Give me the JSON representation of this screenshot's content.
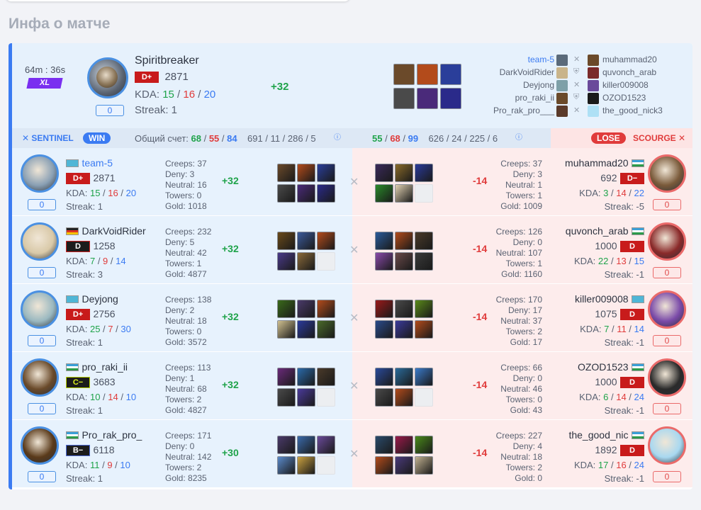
{
  "page": {
    "title": "Инфа о матче"
  },
  "summary": {
    "duration": "64m : 36s",
    "size_badge": "XL",
    "hero_name": "Spiritbreaker",
    "rank": "D+",
    "mmr": "2871",
    "kda_label": "KDA: ",
    "kills": "15",
    "deaths": "16",
    "assists": "20",
    "streak": "Streak: 1",
    "delta": "+32",
    "box_value": "0",
    "items": [
      "#6b4a2a",
      "#b34b1b",
      "#2a3e9a",
      "#4a4a4a",
      "#4a2a7a",
      "#2a2a8a"
    ],
    "sentinel_names": [
      "team-5",
      "DarkVoidRider",
      "Deyjong",
      "pro_raki_ii",
      "Pro_rak_pro___"
    ],
    "scourge_names": [
      "muhammad20",
      "quvonch_arab",
      "killer009008",
      "OZOD1523",
      "the_good_nick3"
    ],
    "mini_left": [
      "#5a6a7a",
      "#c9b48a",
      "#7ea0a8",
      "#6a4a2a",
      "#5a3a2a"
    ],
    "mini_right": [
      "#6b4a2a",
      "#7a2a2a",
      "#6a4a9a",
      "#1a1a1a",
      "#aee0f5"
    ]
  },
  "bar": {
    "sentinel_label": "SENTINEL",
    "win_label": "WIN",
    "score_label": "Общий счет: ",
    "left_k": "68",
    "left_d": "55",
    "left_a": "84",
    "left_extra": "691 / 11 / 286 / 5",
    "right_k": "55",
    "right_d": "68",
    "right_a": "99",
    "right_extra": "626 / 24 / 225 / 6",
    "lose_label": "LOSE",
    "scourge_label": "SCOURGE",
    "info_icon": "info-icon"
  },
  "rows": [
    {
      "l": {
        "name": "team-5",
        "link": true,
        "flag": "kz",
        "rank": "D+",
        "rank_cls": "dp",
        "mmr": "2871",
        "k": "15",
        "d": "16",
        "a": "20",
        "streak": "Streak: 1",
        "box": "0",
        "creeps": "Creeps: 37",
        "deny": "Deny: 3",
        "neutral": "Neutral: 16",
        "towers": "Towers: 0",
        "gold": "Gold: 1018",
        "delta": "+32",
        "items": [
          "#6b4a2a",
          "#b34b1b",
          "#2a3e9a",
          "#4a4a4a",
          "#4a2a7a",
          "#2a2a8a"
        ],
        "avatar": "#8aa0b4"
      },
      "r": {
        "name": "muhammad20",
        "flag": "uz",
        "rank": "D−",
        "rank_cls": "dp",
        "mmr": "692",
        "k": "3",
        "d": "14",
        "a": "22",
        "streak": "Streak: -5",
        "box": "0",
        "creeps": "Creeps: 37",
        "deny": "Deny: 3",
        "neutral": "Neutral: 1",
        "towers": "Towers: 1",
        "gold": "Gold: 1009",
        "delta": "-14",
        "items": [
          "#3a2a5a",
          "#8a6a2a",
          "#2a3a9a",
          "#2a8a2a",
          "#e0d0b0",
          ""
        ],
        "avatar": "#7a5a3a"
      }
    },
    {
      "l": {
        "name": "DarkVoidRider",
        "link": false,
        "flag": "de",
        "rank": "D",
        "rank_cls": "",
        "mmr": "1258",
        "k": "7",
        "d": "9",
        "a": "14",
        "streak": "Streak: 3",
        "box": "0",
        "creeps": "Creeps: 232",
        "deny": "Deny: 5",
        "neutral": "Neutral: 42",
        "towers": "Towers: 1",
        "gold": "Gold: 4877",
        "delta": "+32",
        "items": [
          "#6a4a1a",
          "#3a5a9a",
          "#b34b1b",
          "#4a3a8a",
          "#8a6a3a",
          ""
        ],
        "avatar": "#d9c9a8"
      },
      "r": {
        "name": "quvonch_arab",
        "flag": "uz",
        "rank": "D",
        "rank_cls": "",
        "mmr": "1000",
        "k": "22",
        "d": "13",
        "a": "15",
        "streak": "Streak: -1",
        "box": "0",
        "creeps": "Creeps: 126",
        "deny": "Deny: 0",
        "neutral": "Neutral: 107",
        "towers": "Towers: 1",
        "gold": "Gold: 1160",
        "delta": "-14",
        "items": [
          "#2a5a9a",
          "#b34b1b",
          "#4a3a2a",
          "#8a4aaa",
          "#6a4a4a",
          "#3a3a3a"
        ],
        "avatar": "#8a2a2a"
      }
    },
    {
      "l": {
        "name": "Deyjong",
        "link": false,
        "flag": "kz",
        "rank": "D+",
        "rank_cls": "dp",
        "mmr": "2756",
        "k": "25",
        "d": "7",
        "a": "30",
        "streak": "Streak: 1",
        "box": "0",
        "creeps": "Creeps: 138",
        "deny": "Deny: 2",
        "neutral": "Neutral: 18",
        "towers": "Towers: 0",
        "gold": "Gold: 3572",
        "delta": "+32",
        "items": [
          "#3a6a1a",
          "#4a3a6a",
          "#b34b1b",
          "#d0c090",
          "#2a3a9a",
          "#4a6a2a"
        ],
        "avatar": "#9ab8c0"
      },
      "r": {
        "name": "killer009008",
        "flag": "kz",
        "rank": "D",
        "rank_cls": "",
        "mmr": "1075",
        "k": "7",
        "d": "11",
        "a": "14",
        "streak": "Streak: -1",
        "box": "0",
        "creeps": "Creeps: 170",
        "deny": "Deny: 17",
        "neutral": "Neutral: 37",
        "towers": "Towers: 2",
        "gold": "Gold: 17",
        "delta": "-14",
        "items": [
          "#9a1a1a",
          "#4a4a4a",
          "#5a8a1a",
          "#2a4a8a",
          "#3a3a9a",
          "#b34b1b"
        ],
        "avatar": "#7a4aa8"
      }
    },
    {
      "l": {
        "name": "pro_raki_ii",
        "link": false,
        "flag": "uz",
        "rank": "C−",
        "rank_cls": "c",
        "mmr": "3683",
        "k": "10",
        "d": "14",
        "a": "10",
        "streak": "Streak: 1",
        "box": "0",
        "creeps": "Creeps: 113",
        "deny": "Deny: 1",
        "neutral": "Neutral: 68",
        "towers": "Towers: 2",
        "gold": "Gold: 4827",
        "delta": "+32",
        "items": [
          "#6a2a7a",
          "#2a6aaa",
          "#4a3a2a",
          "#4a4a4a",
          "#4a3a9a",
          ""
        ],
        "avatar": "#6a4a2a"
      },
      "r": {
        "name": "OZOD1523",
        "flag": "uz",
        "rank": "D",
        "rank_cls": "",
        "mmr": "1000",
        "k": "6",
        "d": "14",
        "a": "24",
        "streak": "Streak: -1",
        "box": "0",
        "creeps": "Creeps: 66",
        "deny": "Deny: 0",
        "neutral": "Neutral: 46",
        "towers": "Towers: 0",
        "gold": "Gold: 43",
        "delta": "-14",
        "items": [
          "#2a4a9a",
          "#2a6a9a",
          "#3a7aca",
          "#4a4a4a",
          "#b34b1b",
          ""
        ],
        "avatar": "#2a2a2a"
      }
    },
    {
      "l": {
        "name": "Pro_rak_pro_",
        "link": false,
        "flag": "uz",
        "rank": "B−",
        "rank_cls": "b",
        "mmr": "6118",
        "k": "11",
        "d": "9",
        "a": "10",
        "streak": "Streak: 1",
        "box": "0",
        "creeps": "Creeps: 171",
        "deny": "Deny: 0",
        "neutral": "Neutral: 142",
        "towers": "Towers: 2",
        "gold": "Gold: 8235",
        "delta": "+30",
        "items": [
          "#4a3a6a",
          "#3a6aaa",
          "#6a4a9a",
          "#5a8aca",
          "#c9a040",
          ""
        ],
        "avatar": "#5a3a1a"
      },
      "r": {
        "name": "the_good_nic",
        "flag": "uz",
        "rank": "D",
        "rank_cls": "",
        "mmr": "1892",
        "k": "17",
        "d": "16",
        "a": "24",
        "streak": "Streak: -1",
        "box": "0",
        "creeps": "Creeps: 227",
        "deny": "Deny: 4",
        "neutral": "Neutral: 18",
        "towers": "Towers: 2",
        "gold": "Gold: 0",
        "delta": "-14",
        "items": [
          "#2a4a6a",
          "#9a1a4a",
          "#4a8a1a",
          "#b34b1b",
          "#4a3a7a",
          "#c0b090"
        ],
        "avatar": "#a8d8f0"
      }
    }
  ]
}
